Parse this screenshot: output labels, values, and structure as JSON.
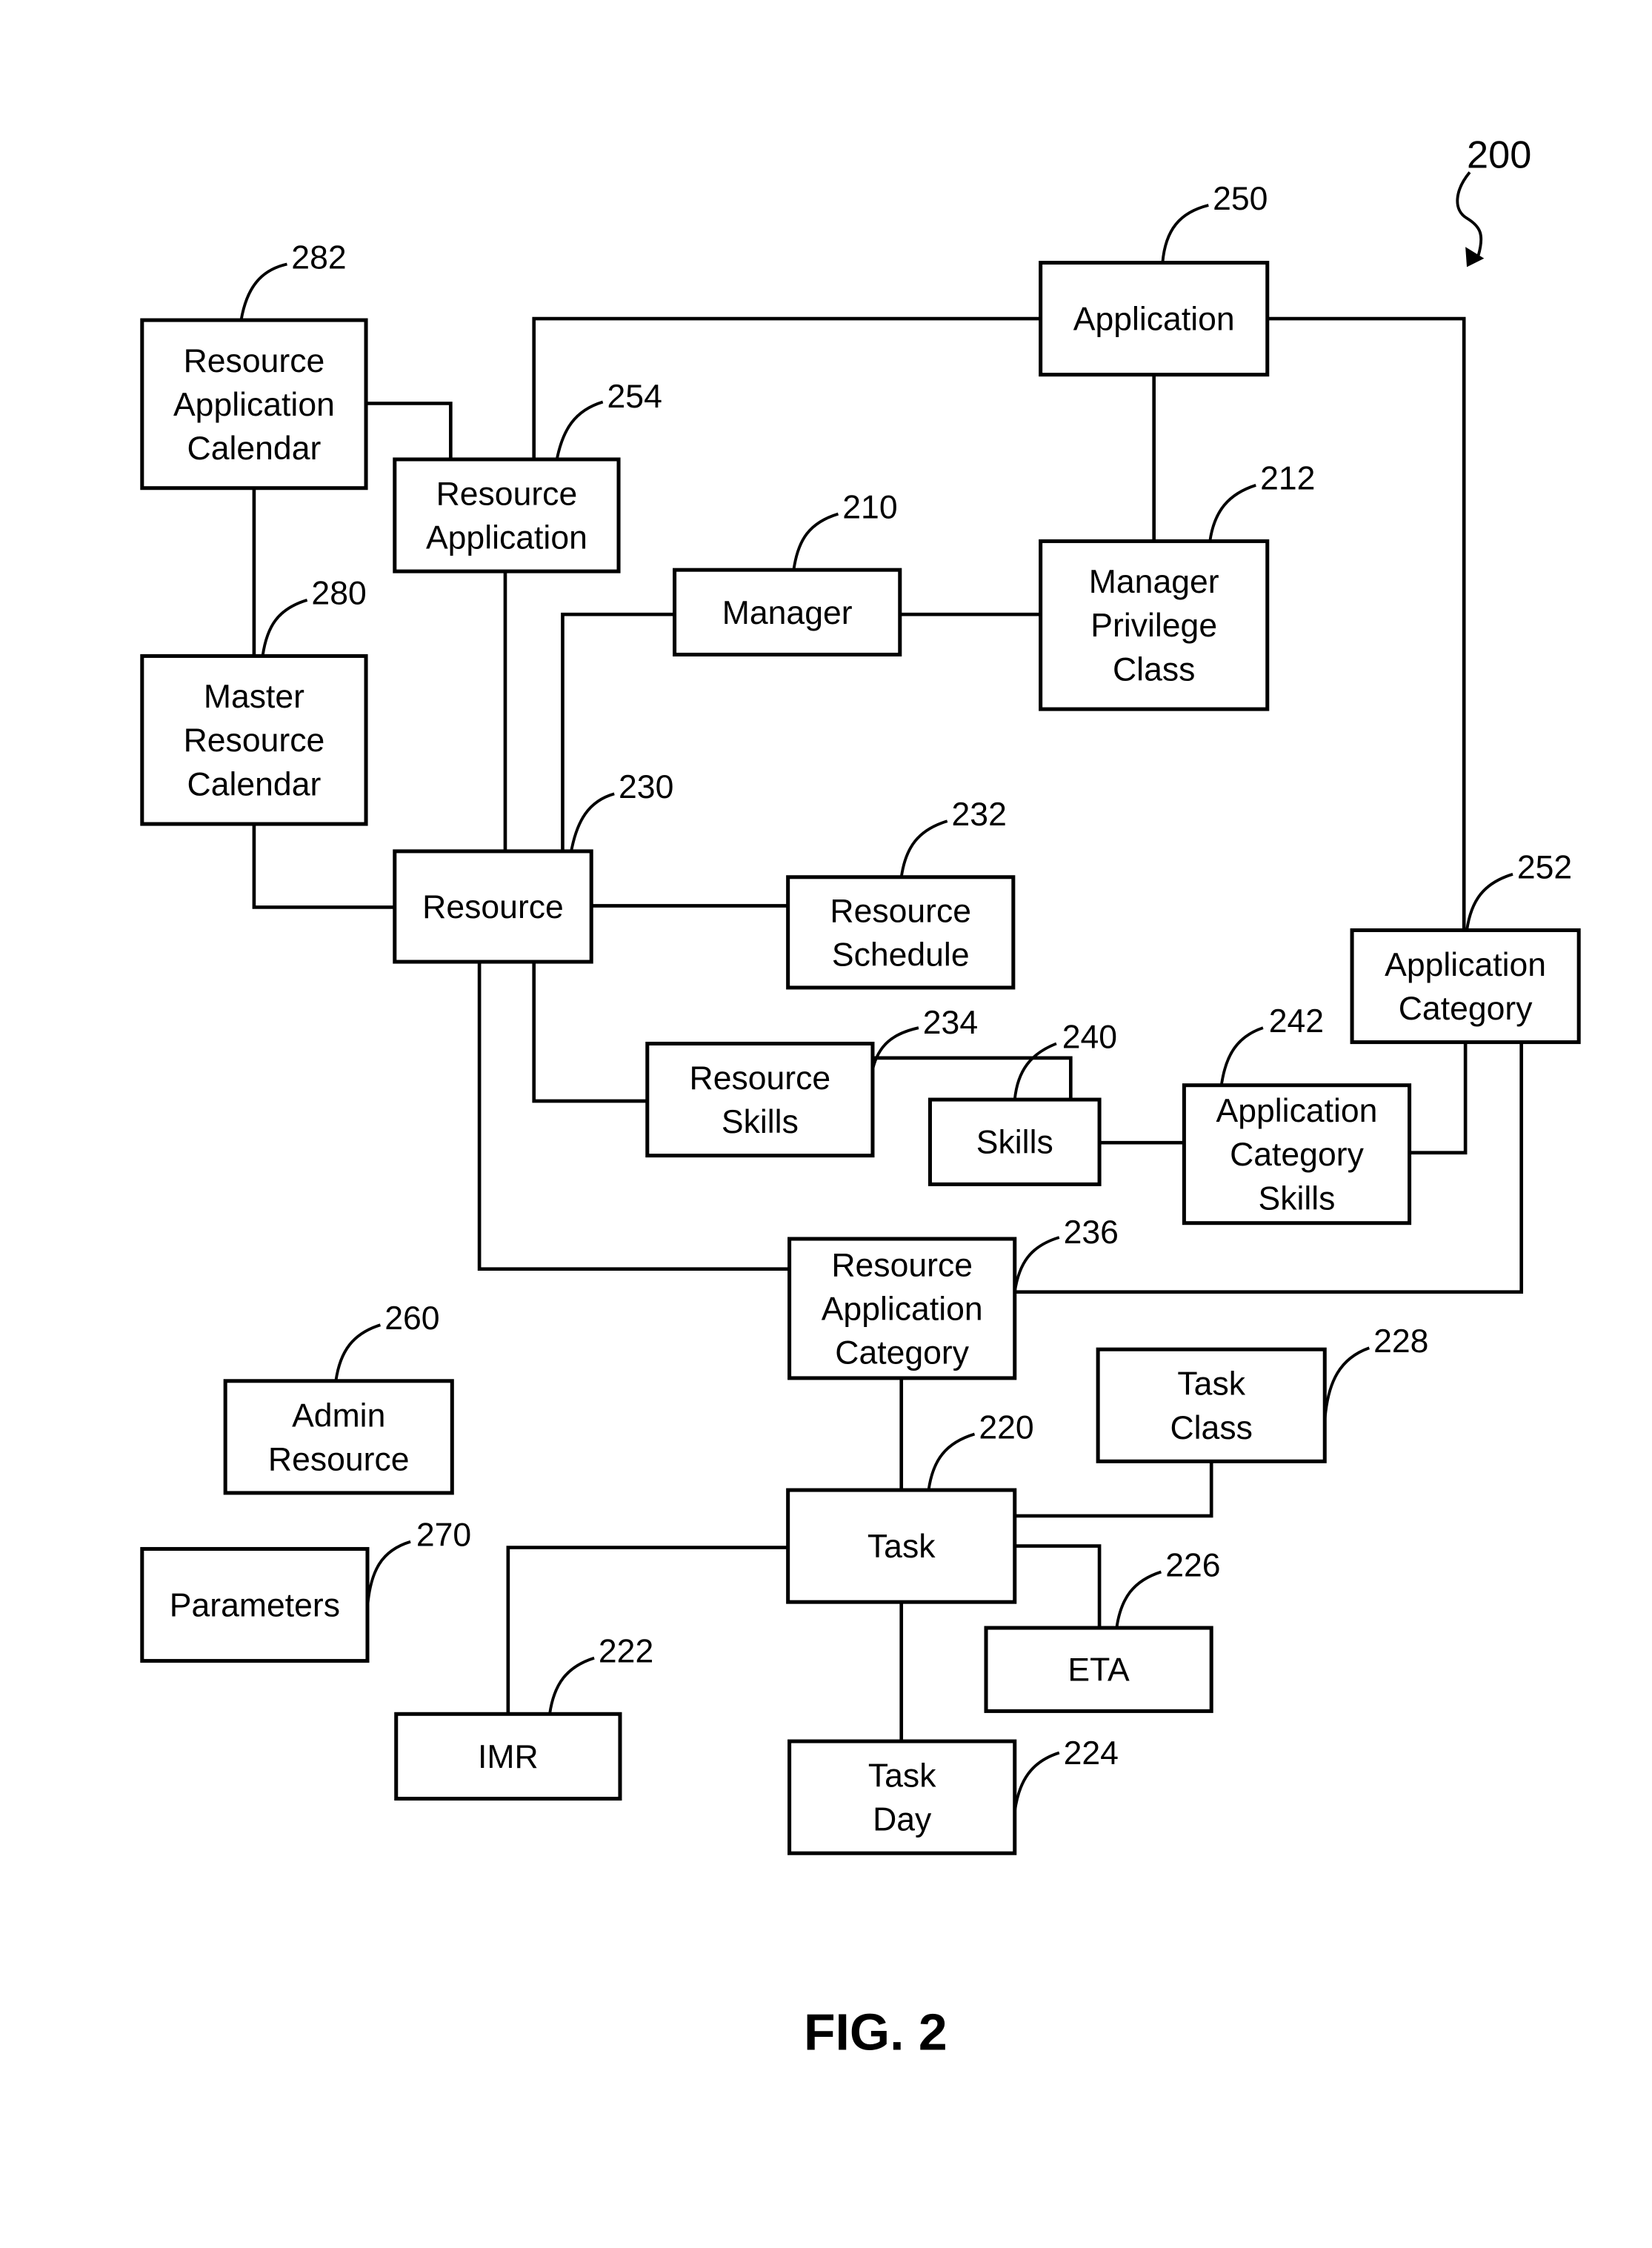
{
  "figure": {
    "title": "FIG. 2",
    "reference": "200"
  },
  "nodes": {
    "resource_application_calendar": {
      "ref": "282",
      "lines": [
        "Resource",
        "Application",
        "Calendar"
      ]
    },
    "resource_application": {
      "ref": "254",
      "lines": [
        "Resource",
        "Application"
      ]
    },
    "application": {
      "ref": "250",
      "lines": [
        "Application"
      ]
    },
    "manager": {
      "ref": "210",
      "lines": [
        "Manager"
      ]
    },
    "manager_privilege_class": {
      "ref": "212",
      "lines": [
        "Manager",
        "Privilege",
        "Class"
      ]
    },
    "master_resource_calendar": {
      "ref": "280",
      "lines": [
        "Master",
        "Resource",
        "Calendar"
      ]
    },
    "resource": {
      "ref": "230",
      "lines": [
        "Resource"
      ]
    },
    "resource_schedule": {
      "ref": "232",
      "lines": [
        "Resource",
        "Schedule"
      ]
    },
    "application_category": {
      "ref": "252",
      "lines": [
        "Application",
        "Category"
      ]
    },
    "resource_skills": {
      "ref": "234",
      "lines": [
        "Resource",
        "Skills"
      ]
    },
    "skills": {
      "ref": "240",
      "lines": [
        "Skills"
      ]
    },
    "application_category_skills": {
      "ref": "242",
      "lines": [
        "Application",
        "Category",
        "Skills"
      ]
    },
    "resource_application_category": {
      "ref": "236",
      "lines": [
        "Resource",
        "Application",
        "Category"
      ]
    },
    "admin_resource": {
      "ref": "260",
      "lines": [
        "Admin",
        "Resource"
      ]
    },
    "task_class": {
      "ref": "228",
      "lines": [
        "Task",
        "Class"
      ]
    },
    "task": {
      "ref": "220",
      "lines": [
        "Task"
      ]
    },
    "parameters": {
      "ref": "270",
      "lines": [
        "Parameters"
      ]
    },
    "eta": {
      "ref": "226",
      "lines": [
        "ETA"
      ]
    },
    "imr": {
      "ref": "222",
      "lines": [
        "IMR"
      ]
    },
    "task_day": {
      "ref": "224",
      "lines": [
        "Task",
        "Day"
      ]
    }
  },
  "connections": [
    [
      "resource_application_calendar",
      "resource_application"
    ],
    [
      "resource_application_calendar",
      "master_resource_calendar"
    ],
    [
      "resource_application",
      "application"
    ],
    [
      "resource_application",
      "resource"
    ],
    [
      "application",
      "manager_privilege_class"
    ],
    [
      "application",
      "application_category"
    ],
    [
      "manager",
      "manager_privilege_class"
    ],
    [
      "manager",
      "resource"
    ],
    [
      "master_resource_calendar",
      "resource"
    ],
    [
      "resource",
      "resource_schedule"
    ],
    [
      "resource",
      "resource_skills"
    ],
    [
      "resource",
      "resource_application_category"
    ],
    [
      "resource_skills",
      "skills"
    ],
    [
      "skills",
      "application_category_skills"
    ],
    [
      "application_category_skills",
      "application_category"
    ],
    [
      "resource_application_category",
      "application_category"
    ],
    [
      "resource_application_category",
      "task"
    ],
    [
      "task",
      "task_class"
    ],
    [
      "task",
      "eta"
    ],
    [
      "task",
      "imr"
    ],
    [
      "task",
      "task_day"
    ]
  ]
}
